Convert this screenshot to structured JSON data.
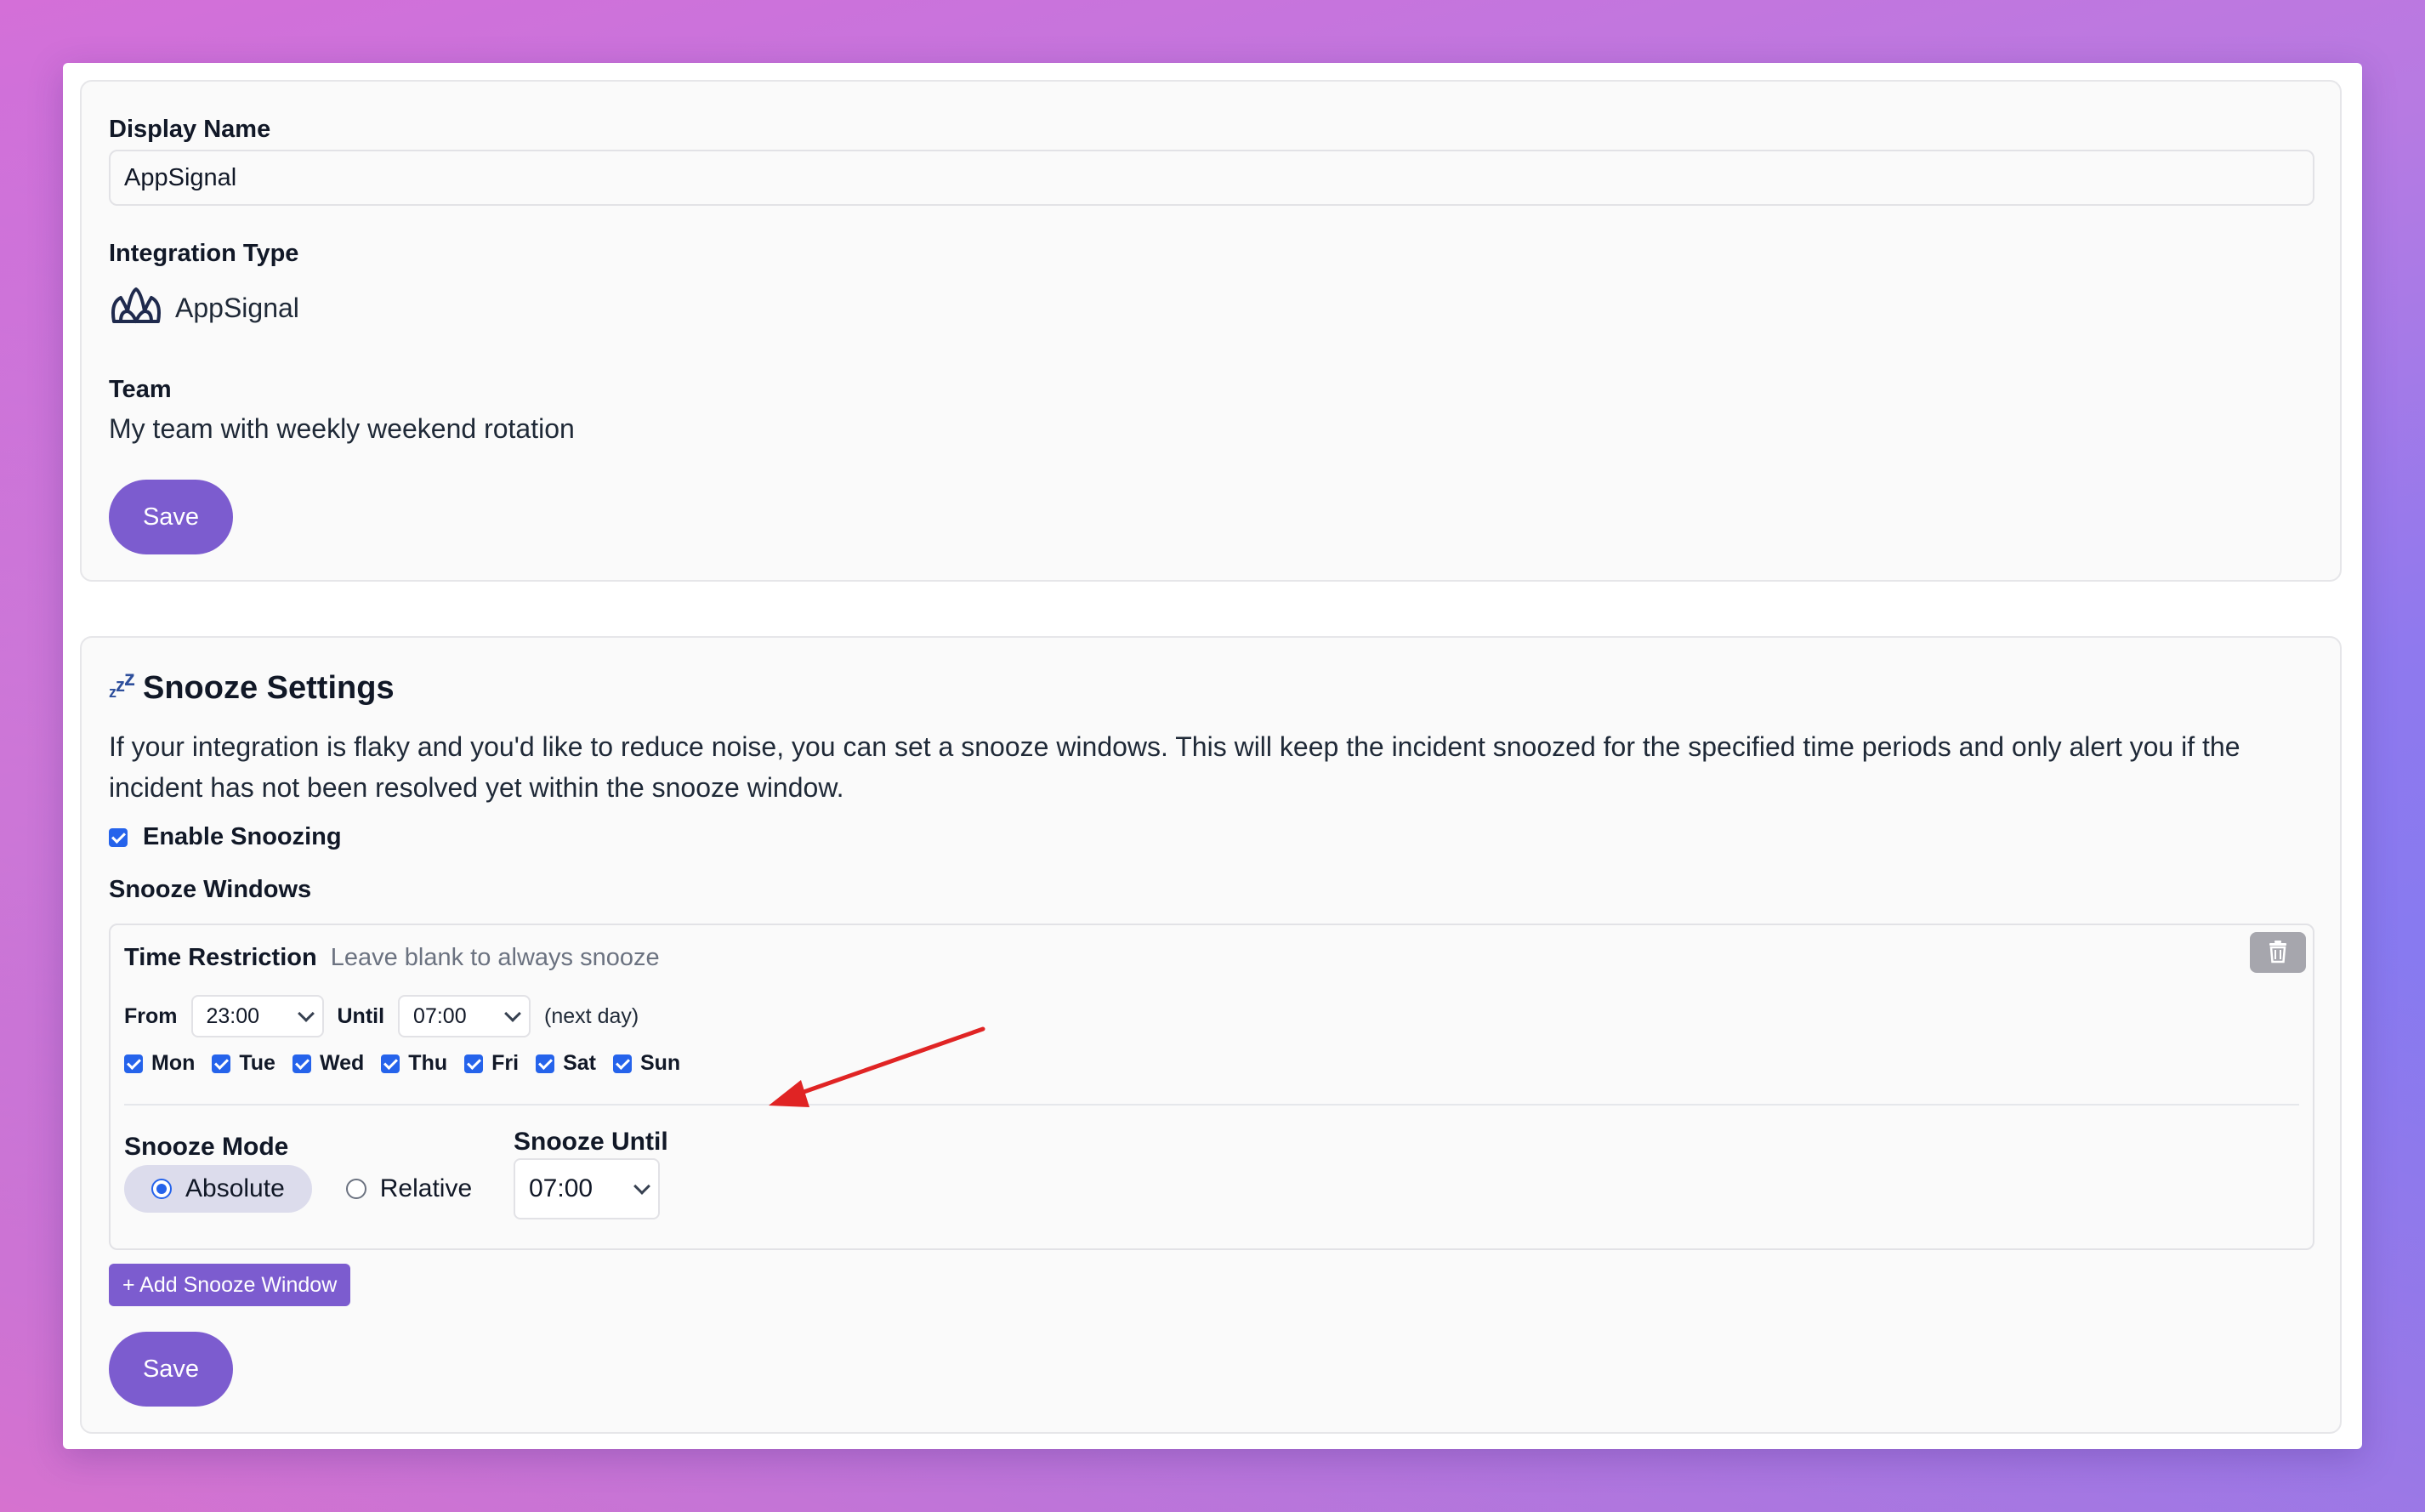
{
  "general": {
    "display_name_label": "Display Name",
    "display_name_value": "AppSignal",
    "integration_type_label": "Integration Type",
    "integration_type_value": "AppSignal",
    "team_label": "Team",
    "team_value": "My team with weekly weekend rotation",
    "save_label": "Save"
  },
  "snooze": {
    "title": "Snooze Settings",
    "description": "If your integration is flaky and you'd like to reduce noise, you can set a snooze windows. This will keep the incident snoozed for the specified time periods and only alert you if the incident has not been resolved yet within the snooze window.",
    "enable_label": "Enable Snoozing",
    "enable_checked": true,
    "windows_label": "Snooze Windows",
    "window": {
      "time_restriction_label": "Time Restriction",
      "time_restriction_hint": "Leave blank to always snooze",
      "from_label": "From",
      "from_value": "23:00",
      "until_label": "Until",
      "until_value": "07:00",
      "next_day_note": "(next day)",
      "days": [
        {
          "label": "Mon",
          "checked": true
        },
        {
          "label": "Tue",
          "checked": true
        },
        {
          "label": "Wed",
          "checked": true
        },
        {
          "label": "Thu",
          "checked": true
        },
        {
          "label": "Fri",
          "checked": true
        },
        {
          "label": "Sat",
          "checked": true
        },
        {
          "label": "Sun",
          "checked": true
        }
      ],
      "snooze_mode_label": "Snooze Mode",
      "mode_options": [
        "Absolute",
        "Relative"
      ],
      "mode_selected": "Absolute",
      "snooze_until_label": "Snooze Until",
      "snooze_until_value": "07:00"
    },
    "add_window_label": "+ Add Snooze Window",
    "save_label": "Save"
  },
  "colors": {
    "accent": "#7c5ccf",
    "checkbox": "#2563eb",
    "annotation_arrow": "#e02424"
  },
  "icons": {
    "integration": "appsignal-logo-icon",
    "snooze": "zzz-icon",
    "delete": "trash-icon",
    "annotation": "red-arrow-annotation"
  }
}
